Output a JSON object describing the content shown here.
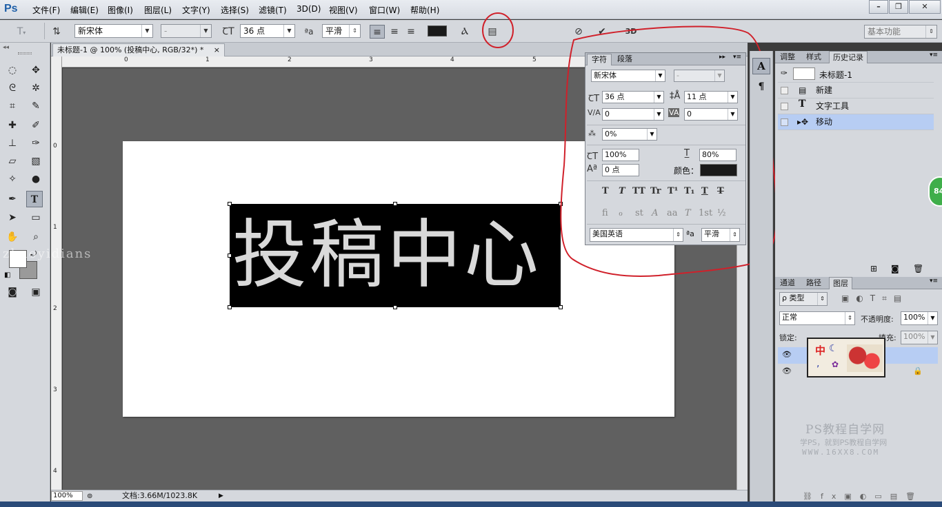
{
  "menubar": {
    "logo": "Ps",
    "items": [
      "文件(F)",
      "编辑(E)",
      "图像(I)",
      "图层(L)",
      "文字(Y)",
      "选择(S)",
      "滤镜(T)",
      "3D(D)",
      "视图(V)",
      "窗口(W)",
      "帮助(H)"
    ],
    "minimize": "–",
    "restore": "❐",
    "close": "✕"
  },
  "options": {
    "font_family": "新宋体",
    "font_style": "-",
    "font_size": "36 点",
    "aa_icon": "ªa",
    "antialias": "平滑",
    "text_color": "#1a1a1a",
    "workspace": "基本功能"
  },
  "document": {
    "tab_title": "未标题-1 @ 100% (投稿中心, RGB/32*) *",
    "tab_close": "×",
    "text_content": "投稿中心",
    "zoom": "100%",
    "doc_info": "文档:3.66M/1023.8K",
    "ruler_top": [
      "0",
      "1",
      "2",
      "3",
      "4",
      "5"
    ],
    "ruler_left": [
      "0",
      "1",
      "2",
      "3",
      "4"
    ]
  },
  "char_panel": {
    "tab_char": "字符",
    "tab_para": "段落",
    "font_family": "新宋体",
    "font_style": "-",
    "font_size": "36 点",
    "leading": "11 点",
    "kerning": "0",
    "tracking": "0",
    "scale_percent": "0%",
    "vertical_scale": "100%",
    "horizontal_scale": "80%",
    "baseline_shift": "0 点",
    "color_label": "颜色：",
    "color_value": "#1a1a1a",
    "style_buttons": [
      "T",
      "T",
      "TT",
      "Tr",
      "T¹",
      "T₁",
      "T",
      "T"
    ],
    "opentype_buttons": [
      "fi",
      "ℴ",
      "st",
      "A",
      "aa",
      "T",
      "1st",
      "½"
    ],
    "language": "美国英语",
    "aa_icon": "ªa",
    "antialias": "平滑"
  },
  "history_panel": {
    "tabs": [
      "调整",
      "样式",
      "历史记录"
    ],
    "snapshot": "未标题-1",
    "items": [
      "新建",
      "文字工具",
      "移动"
    ]
  },
  "layers_panel": {
    "tabs": [
      "通道",
      "路径",
      "图层"
    ],
    "filter": "ρ 类型",
    "blend_mode": "正常",
    "opacity_label": "不透明度:",
    "opacity": "100%",
    "lock_label": "锁定:",
    "fill_label": "填充:",
    "fill": "100%"
  },
  "watermark": {
    "title": "PS教程自学网",
    "subtitle": "学PS，就到PS教程自学网",
    "url": "WWW.16XX8.COM",
    "overlay": "zhaoyidians"
  },
  "badge": "84"
}
